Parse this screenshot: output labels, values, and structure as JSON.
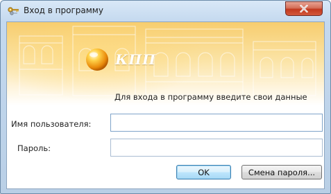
{
  "window": {
    "title": "Вход в программу",
    "icon": "keys-icon",
    "close_icon": "close-icon"
  },
  "banner": {
    "brand": "КПП",
    "hint": "Для входа в программу введите свои данные"
  },
  "form": {
    "username_label": "Имя пользователя:",
    "username_value": "",
    "password_label": "Пароль:",
    "password_value": ""
  },
  "buttons": {
    "ok_label": "OK",
    "change_password_label": "Смена пароля..."
  },
  "colors": {
    "banner_gold": "#f7cd6e",
    "title_bar": "#c4d9ef",
    "close_red": "#c2391e"
  }
}
